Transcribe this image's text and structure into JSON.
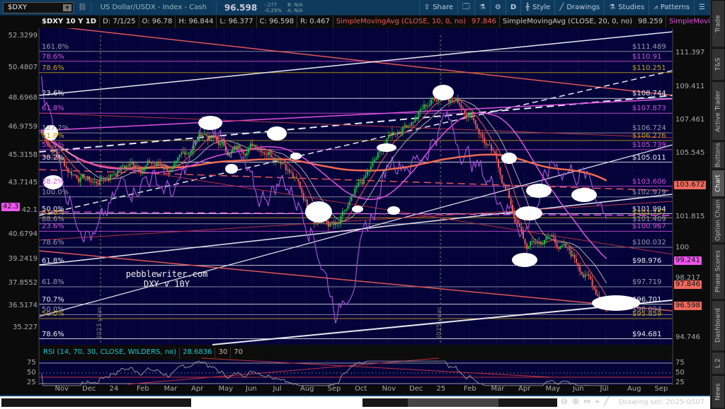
{
  "toolbar": {
    "symbol": "$DXY",
    "description": "US Dollar/USDX - Index - Cash",
    "last": "96.598",
    "change": "-.277",
    "change_pct": "-0.29%",
    "bid": "B: N/A",
    "ask": "A: N/A",
    "share": "Share",
    "period": "D",
    "style": "Style",
    "drawings": "Drawings",
    "studies": "Studies",
    "patterns": "Patterns"
  },
  "info": {
    "title": "$DXY 10 Y 1D",
    "date": "D: 7/1/25",
    "open": "O: 96.78",
    "high": "H: 96.844",
    "low": "L: 96.377",
    "close": "C: 96.598",
    "range": "R: 0.467",
    "sma1": "SimpleMovingAvg (CLOSE, 10, 0, no)",
    "sma1_val": "97.846",
    "sma2": "SimpleMovingAvg (CLOSE, 20, 0, no)",
    "sma2_val": "98.259",
    "sma3": "SimpleMovingAvg ..."
  },
  "right_axis": [
    "111.397",
    "109.411",
    "107.461",
    "105.545",
    "101.815",
    "100",
    "98.217",
    "94.746"
  ],
  "left_axis": [
    "52.3299",
    "50.4807",
    "48.6968",
    "46.9759",
    "45.3158",
    "43.7145",
    "42.1",
    "40.6794",
    "39.2419",
    "37.8552",
    "36.5174",
    "35.227"
  ],
  "price_tags": [
    {
      "text": "103.672",
      "color": "#f06a5e"
    },
    {
      "text": "99.241",
      "color": "#ee55ee"
    },
    {
      "text": "97.846",
      "color": "#f06a5e"
    },
    {
      "text": "96.598",
      "color": "#f06a5e"
    }
  ],
  "left_tag": "42.3",
  "levels": [
    {
      "price": "$111.489",
      "fib": "161.8%",
      "color": "#9a9aa8"
    },
    {
      "price": "$110.91",
      "fib": "78.6%",
      "color": "#d050d8"
    },
    {
      "price": "$110.251",
      "fib": "78.6%",
      "color": "#c8a010"
    },
    {
      "price": "$108.744",
      "fib": "23.6%",
      "color": "#e8e8f0"
    },
    {
      "price": "$107.873",
      "fib": "61.8%",
      "color": "#d050d8"
    },
    {
      "price": "$106.724",
      "fib": "127.2%",
      "color": "#9a9aa8"
    },
    {
      "price": "$106.276",
      "fib": "61.8%",
      "color": "#c8a010"
    },
    {
      "price": "$105.739",
      "fib": "50.0%",
      "color": "#d050d8"
    },
    {
      "price": "$105.011",
      "fib": "38.2%",
      "color": "#e8e8f0"
    },
    {
      "price": "$103.606",
      "fib": "38.2%",
      "color": "#d050d8"
    },
    {
      "price": "$102.979",
      "fib": "100.0%",
      "color": "#9a9aa8"
    },
    {
      "price": "$101.994",
      "fib": "50.0%",
      "color": "#e8e8f0"
    },
    {
      "price": "$101.757",
      "fib": "61.8%",
      "color": "#c8a010"
    },
    {
      "price": "$101.409",
      "fib": "88.6%",
      "color": "#9a9aa8"
    },
    {
      "price": "$100.967",
      "fib": "23.6%",
      "color": "#d050d8"
    },
    {
      "price": "$100.032",
      "fib": "78.6%",
      "color": "#9a9aa8"
    },
    {
      "price": "$98.976",
      "fib": "61.8%",
      "color": "#e8e8f0"
    },
    {
      "price": "$97.719",
      "fib": "61.8%",
      "color": "#9a9aa8"
    },
    {
      "price": "$96.701",
      "fib": "70.7%",
      "color": "#e8e8f0"
    },
    {
      "price": "$96.094",
      "fib": "50.0%",
      "color": "#9a9aa8"
    },
    {
      "price": "$95.859",
      "fib": "50.0%",
      "color": "#c8a010"
    },
    {
      "price": "$94.681",
      "fib": "78.6%",
      "color": "#e8e8f0"
    }
  ],
  "annotation": {
    "line1": "pebblewriter.com",
    "line2": "DXY v 10Y"
  },
  "year_markers": [
    "2023 year",
    "2025 year"
  ],
  "months": [
    "Nov",
    "Dec",
    "24",
    "Feb",
    "Mar",
    "Apr",
    "May",
    "Jun",
    "Jul",
    "Aug",
    "Sep",
    "Oct",
    "Nov",
    "Dec",
    "25",
    "Feb",
    "Mar",
    "Apr",
    "May",
    "Jun",
    "Jul",
    "Aug",
    "Sep"
  ],
  "rsi": {
    "label": "RSI (14, 70, 30, CLOSE, WILDERS, no)",
    "value": "28.6836",
    "lo": "30",
    "hi": "70",
    "axis": [
      "75",
      "50",
      "25"
    ]
  },
  "dxy_path": [
    106.8,
    104.6,
    103.8,
    104.8,
    105.0,
    104.6,
    106.8,
    105.6,
    106.2,
    105.4,
    102.2,
    101.1,
    103.8,
    106.6,
    107.9,
    109.3,
    107.9,
    104.6,
    100.0,
    100.6,
    99.0,
    96.6
  ],
  "tnx_path": [
    50.0,
    43.0,
    40.4,
    43.5,
    44.2,
    43.0,
    46.8,
    46.3,
    42.6,
    44.0,
    41.5,
    36.0,
    40.2,
    45.3,
    45.0,
    47.5,
    45.0,
    43.2,
    41.0,
    44.8,
    44.4,
    42.3
  ],
  "bottom": {
    "drawing_set": "Drawing set: 2025-0507"
  },
  "sidebar_tabs": [
    "Trade",
    "T&S",
    "Active Trader",
    "Buttons",
    "Chart",
    "Option Chain",
    "Phase Scores",
    "Dashboard",
    "L 2",
    "News"
  ],
  "colors": {
    "chart_bg": "#03033a",
    "candle_up": "#22c040",
    "candle_down": "#f05a50",
    "sma10": "#f05a50",
    "sma20": "#aaaaaa",
    "sma50": "#e050e0",
    "sma200": "#f06a50",
    "tnx": "#a050d0"
  }
}
